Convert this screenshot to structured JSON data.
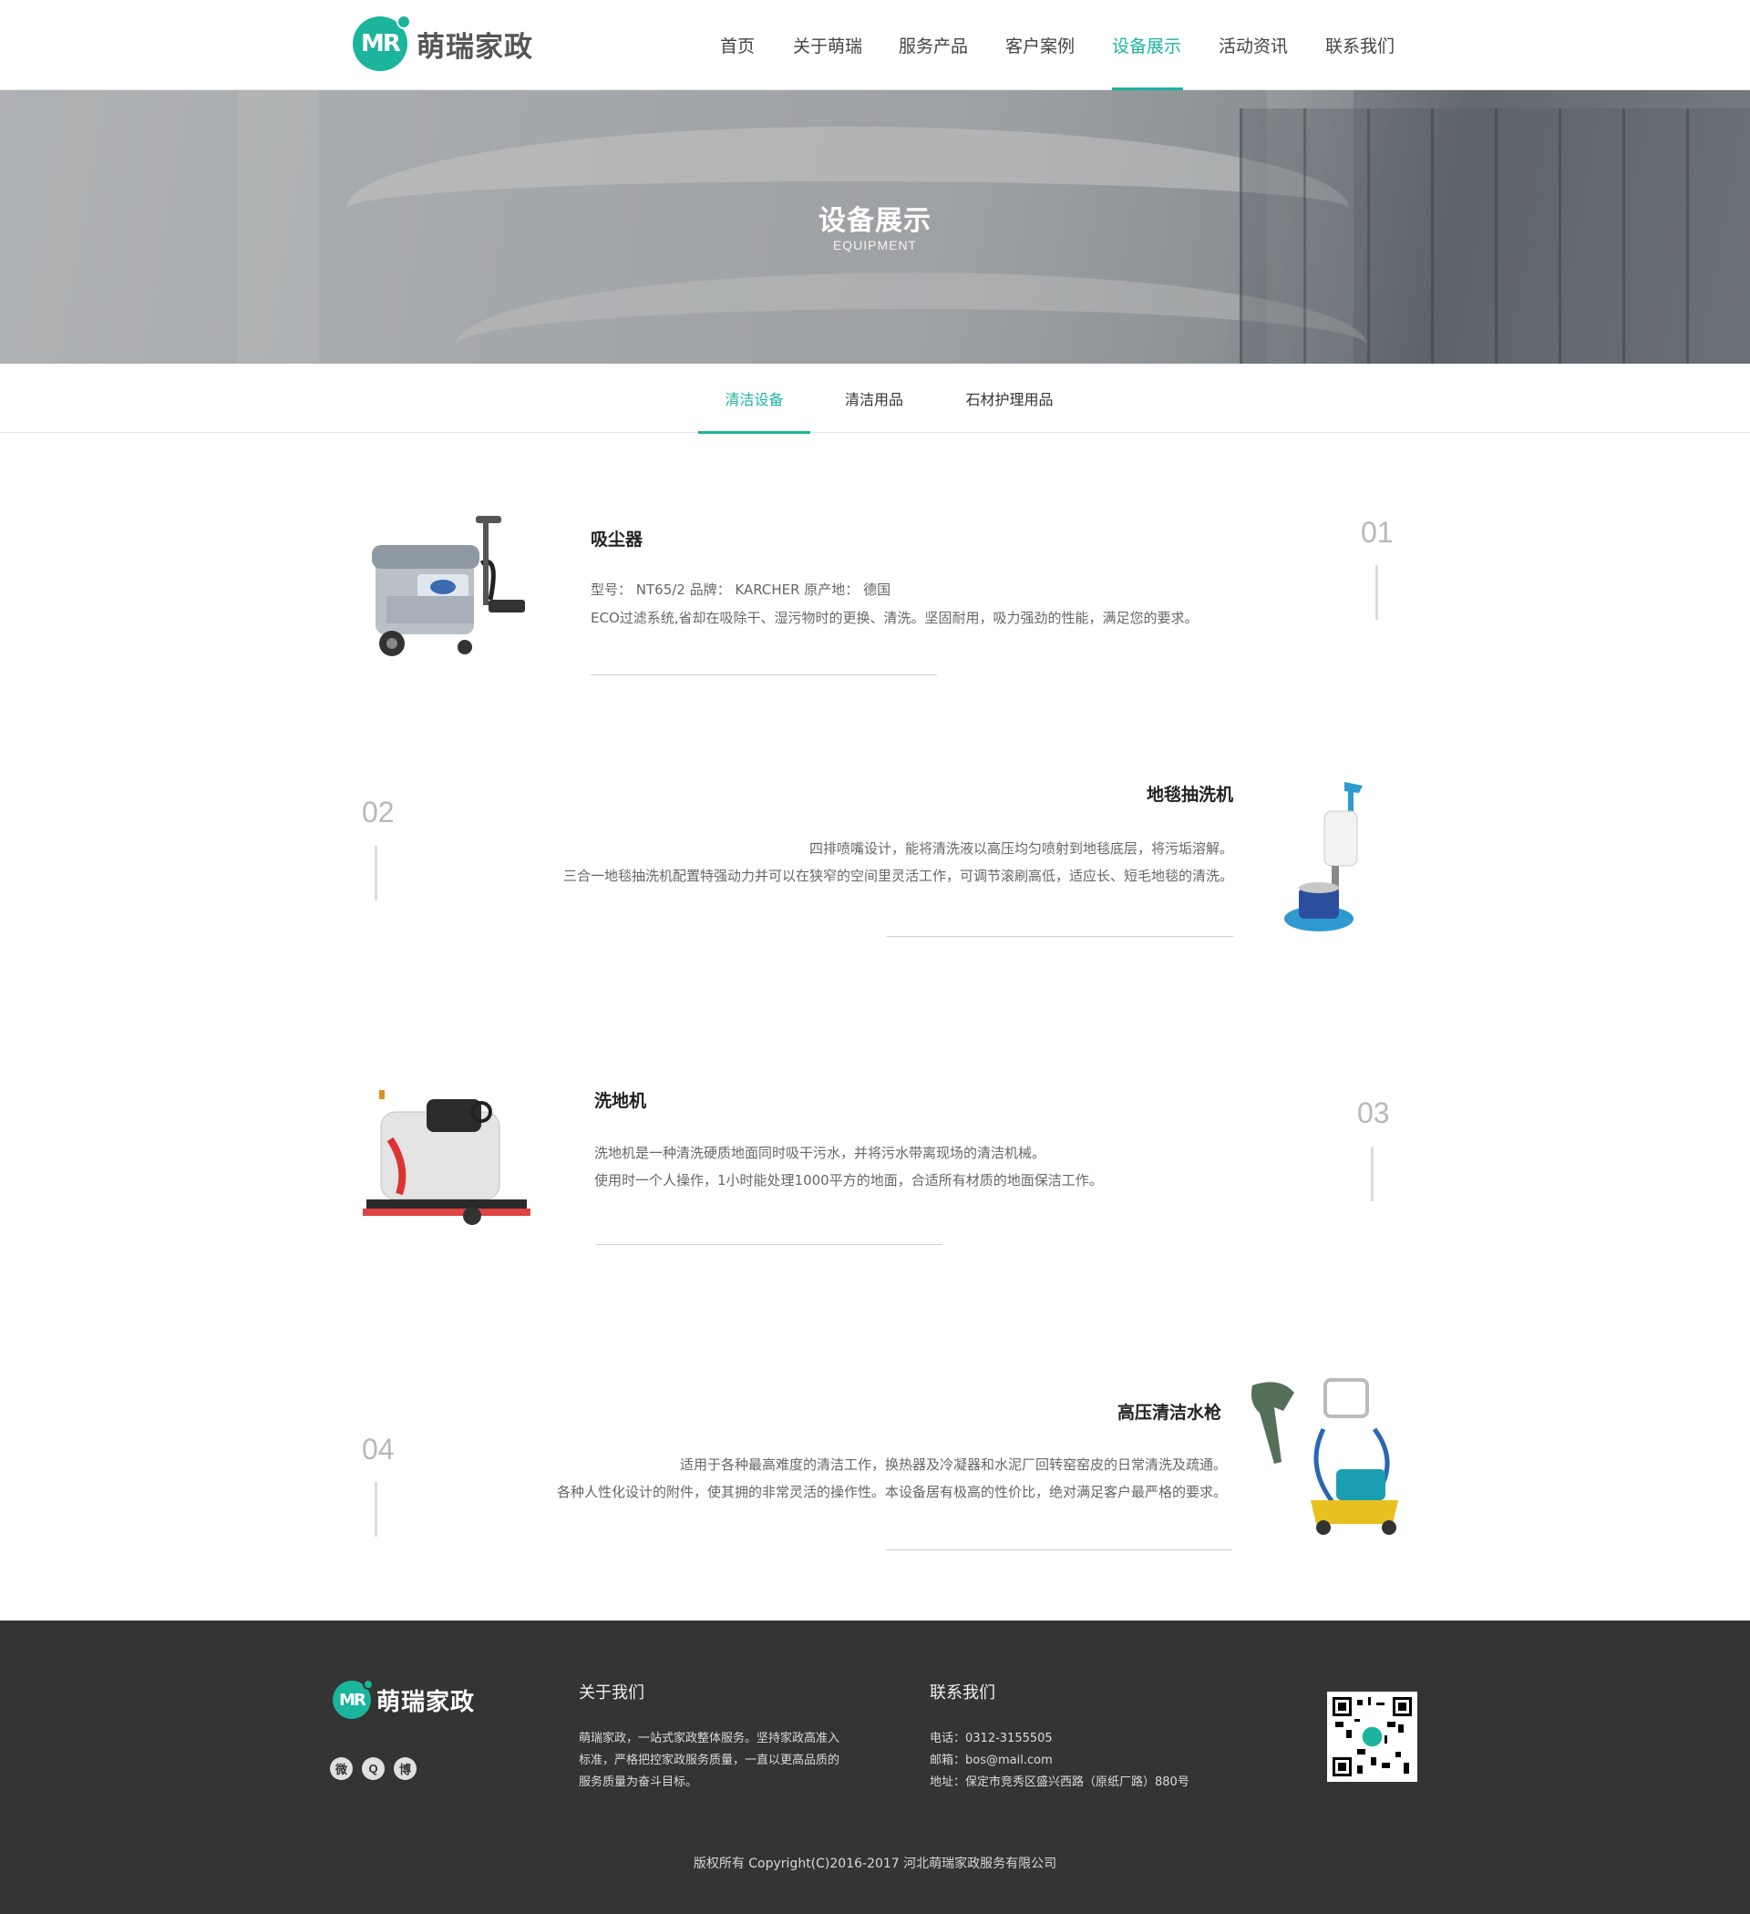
{
  "header": {
    "logo_mark": "MR",
    "logo_text": "萌瑞家政",
    "nav": [
      {
        "label": "首页",
        "active": false
      },
      {
        "label": "关于萌瑞",
        "active": false
      },
      {
        "label": "服务产品",
        "active": false
      },
      {
        "label": "客户案例",
        "active": false
      },
      {
        "label": "设备展示",
        "active": true
      },
      {
        "label": "活动资讯",
        "active": false
      },
      {
        "label": "联系我们",
        "active": false
      }
    ]
  },
  "banner": {
    "title": "设备展示",
    "subtitle": "EQUIPMENT"
  },
  "subtabs": [
    {
      "label": "清洁设备",
      "active": true
    },
    {
      "label": "清洁用品",
      "active": false
    },
    {
      "label": "石材护理用品",
      "active": false
    }
  ],
  "items": [
    {
      "number": "01",
      "title": "吸尘器",
      "lines": [
        "型号： NT65/2  品牌： KARCHER 原产地： 德国",
        "ECO过滤系统,省却在吸除干、湿污物时的更换、清洗。坚固耐用，吸力强劲的性能，满足您的要求。"
      ],
      "image_icon": "vacuum-cleaner-image"
    },
    {
      "number": "02",
      "title": "地毯抽洗机",
      "lines": [
        "四排喷嘴设计，能将清洗液以高压均匀喷射到地毯底层，将污垢溶解。",
        "三合一地毯抽洗机配置特强动力并可以在狭窄的空间里灵活工作，可调节滚刷高低，适应长、短毛地毯的清洗。"
      ],
      "image_icon": "carpet-extractor-image"
    },
    {
      "number": "03",
      "title": "洗地机",
      "lines": [
        "洗地机是一种清洗硬质地面同时吸干污水，并将污水带离现场的清洁机械。",
        "使用时一个人操作，1小时能处理1000平方的地面，合适所有材质的地面保洁工作。"
      ],
      "image_icon": "floor-scrubber-image"
    },
    {
      "number": "04",
      "title": "高压清洁水枪",
      "lines": [
        "适用于各种最高难度的清洁工作，换热器及冷凝器和水泥厂回转窑窑皮的日常清洗及疏通。",
        "各种人性化设计的附件，使其拥的非常灵活的操作性。本设备居有极高的性价比，绝对满足客户最严格的要求。"
      ],
      "image_icon": "pressure-washer-image"
    }
  ],
  "footer": {
    "logo_mark": "MR",
    "logo_text": "萌瑞家政",
    "social": [
      {
        "icon": "wechat-icon",
        "glyph": "微"
      },
      {
        "icon": "qq-icon",
        "glyph": "Q"
      },
      {
        "icon": "weibo-icon",
        "glyph": "博"
      }
    ],
    "about_heading": "关于我们",
    "about_lines": [
      "萌瑞家政，一站式家政整体服务。坚持家政高准入",
      "标准，严格把控家政服务质量，一直以更高品质的",
      "服务质量为奋斗目标。"
    ],
    "contact_heading": "联系我们",
    "contact_lines": [
      "电话：0312-3155505",
      "邮箱：bos@mail.com",
      "地址：保定市竞秀区盛兴西路（原纸厂路）880号"
    ],
    "copyright": "版权所有 Copyright(C)2016-2017 河北萌瑞家政服务有限公司"
  },
  "colors": {
    "accent": "#1bb49c",
    "footer_bg": "#343434"
  }
}
